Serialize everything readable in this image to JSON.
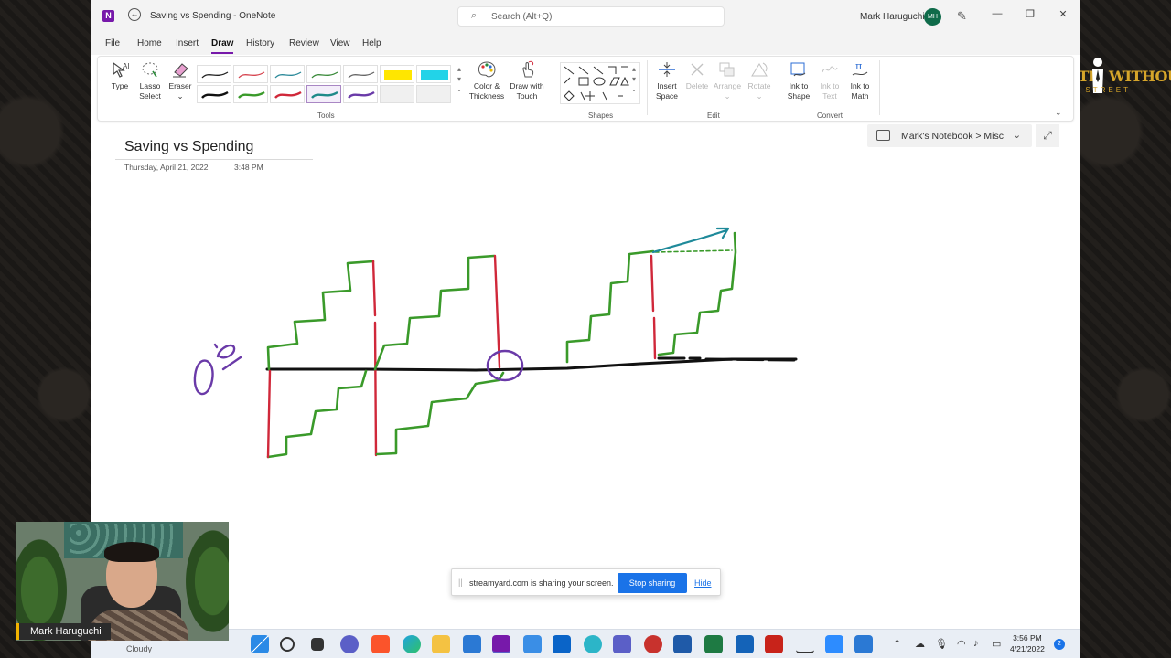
{
  "window": {
    "title": "Saving vs Spending  -  OneNote",
    "search_placeholder": "Search (Alt+Q)",
    "user_name": "Mark Haruguchi",
    "user_initials": "MH"
  },
  "menu": [
    "File",
    "Home",
    "Insert",
    "Draw",
    "History",
    "Review",
    "View",
    "Help"
  ],
  "active_menu": "Draw",
  "ribbon": {
    "tools": {
      "type": "Type",
      "lasso_1": "Lasso",
      "lasso_2": "Select",
      "eraser": "Eraser",
      "color_1": "Color &",
      "color_2": "Thickness",
      "draw_touch_1": "Draw with",
      "draw_touch_2": "Touch",
      "group_label": "Tools"
    },
    "pens_row1": [
      "#222222",
      "#d64550",
      "#2c8a9a",
      "#3a8a3a",
      "#666666",
      "#ffe600",
      "#22d3e8"
    ],
    "pens_row2": [
      "#111111",
      "#3a9a2a",
      "#d0283a",
      "#1f8a8a",
      "#6a3aa8",
      "#e6e6e6",
      "#e6e6e6"
    ],
    "shapes_label": "Shapes",
    "edit": {
      "insert_space_1": "Insert",
      "insert_space_2": "Space",
      "delete": "Delete",
      "arrange": "Arrange",
      "rotate": "Rotate",
      "group_label": "Edit"
    },
    "convert": {
      "ink_shape_1": "Ink to",
      "ink_shape_2": "Shape",
      "ink_text_1": "Ink to",
      "ink_text_2": "Text",
      "ink_math_1": "Ink to",
      "ink_math_2": "Math",
      "group_label": "Convert"
    }
  },
  "page": {
    "title": "Saving vs Spending",
    "date": "Thursday, April 21, 2022",
    "time": "3:48 PM",
    "notebook_path": "Mark's Notebook > Misc"
  },
  "share_bar": {
    "message": "streamyard.com is sharing your screen.",
    "stop_label": "Stop sharing",
    "hide_label": "Hide"
  },
  "taskbar": {
    "weather": "Cloudy",
    "time": "3:56 PM",
    "date": "4/21/2022",
    "notifications": "2"
  },
  "overlay": {
    "presenter_name": "Mark Haruguchi",
    "brand_word_1": "WEALTH",
    "brand_word_2": "WITHOUT",
    "brand_sub": "WALL STREET"
  },
  "colors": {
    "onenote_purple": "#7719aa",
    "ink_black": "#111111",
    "ink_green": "#3a9a2a",
    "ink_red": "#d0283a",
    "ink_purple": "#6a3aa8",
    "ink_teal": "#1f8a9a",
    "accent_blue": "#1a73e8"
  }
}
